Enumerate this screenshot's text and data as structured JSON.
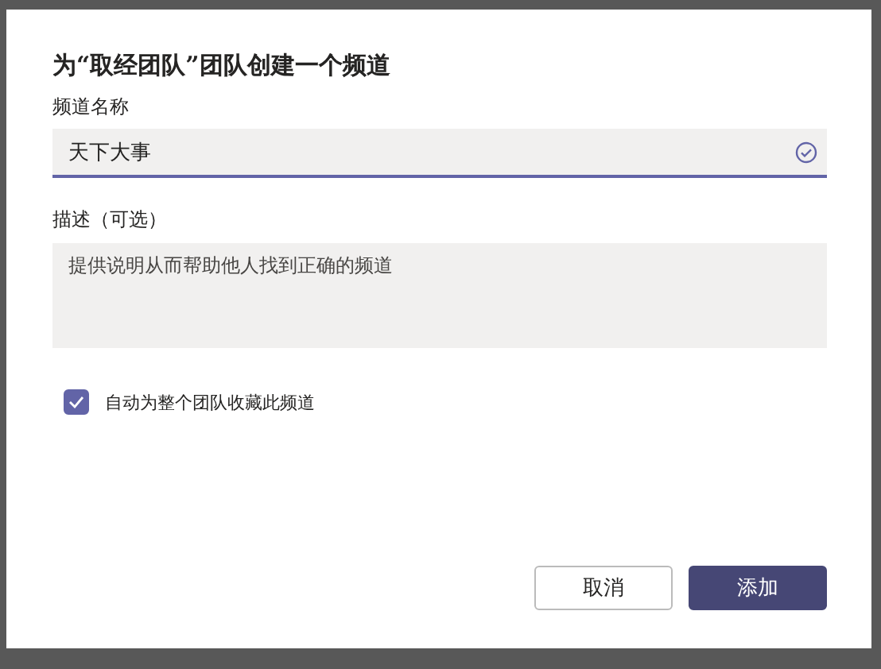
{
  "dialog": {
    "title": "为“取经团队”团队创建一个频道"
  },
  "name_field": {
    "label": "频道名称",
    "value": "天下大事",
    "valid": true
  },
  "description_field": {
    "label": "描述（可选）",
    "placeholder": "提供说明从而帮助他人找到正确的频道"
  },
  "favorite_checkbox": {
    "label": "自动为整个团队收藏此频道",
    "checked": true
  },
  "buttons": [
    {
      "label": "取消",
      "kind": "secondary"
    },
    {
      "label": "添加",
      "kind": "primary"
    }
  ]
}
